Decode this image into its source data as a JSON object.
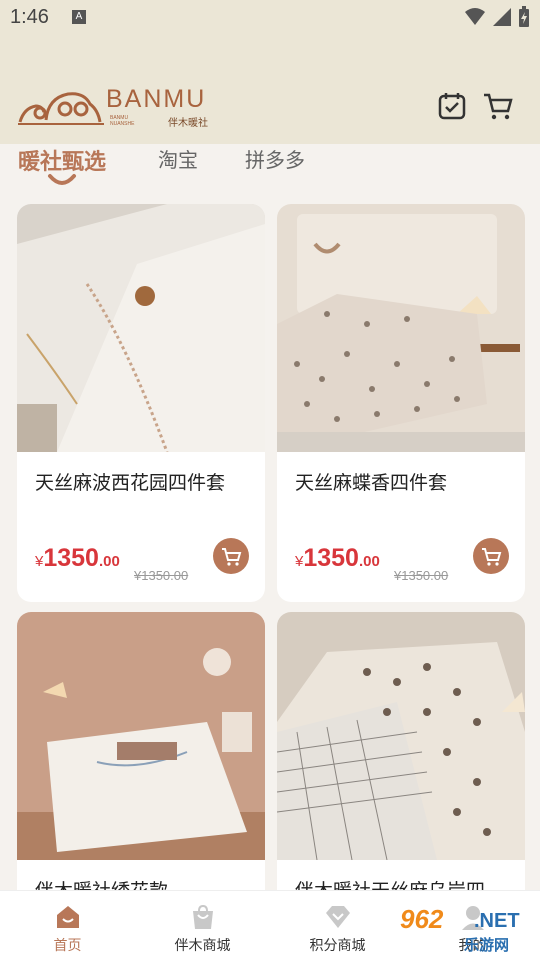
{
  "status_bar": {
    "time": "1:46",
    "notification_letter": "A"
  },
  "header": {
    "logo_text": "BANMU",
    "logo_sub_line1": "BANMU",
    "logo_sub_line2": "NUANSHE",
    "logo_cn": "伴木暖社",
    "icons": [
      "checkin-calendar-icon",
      "shopping-cart-icon"
    ]
  },
  "tabs": [
    {
      "label": "暖社甄选",
      "active": true
    },
    {
      "label": "淘宝",
      "active": false
    },
    {
      "label": "拼多多",
      "active": false
    }
  ],
  "products": [
    {
      "title": "天丝麻波西花园四件套",
      "currency": "¥",
      "price_int": "1350",
      "price_dec": ".00",
      "old_price": "¥1350.00"
    },
    {
      "title": "天丝麻蝶香四件套",
      "currency": "¥",
      "price_int": "1350",
      "price_dec": ".00",
      "old_price": "¥1350.00"
    },
    {
      "title": "伴木暖社绣花款",
      "currency": "",
      "price_int": "",
      "price_dec": "",
      "old_price": ""
    },
    {
      "title": "伴木暖社天丝麻乌岸四",
      "currency": "",
      "price_int": "",
      "price_dec": "",
      "old_price": ""
    }
  ],
  "bottom_nav": [
    {
      "label": "首页",
      "icon": "home-icon",
      "active": true
    },
    {
      "label": "伴木商城",
      "icon": "shopping-bag-icon",
      "active": false
    },
    {
      "label": "积分商城",
      "icon": "diamond-icon",
      "active": false
    },
    {
      "label": "我的",
      "icon": "profile-icon",
      "active": false
    }
  ],
  "watermark": {
    "number": "962",
    "domain": ".NET",
    "cn": "乐游网"
  },
  "colors": {
    "accent": "#b87758",
    "price": "#d8363b",
    "header_bg": "#ebe6d6"
  }
}
